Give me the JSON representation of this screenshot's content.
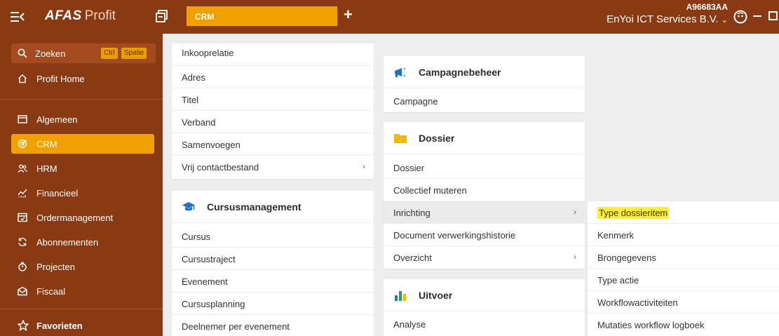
{
  "topbar": {
    "brand": "AFAS",
    "product": "Profit",
    "active_tab": "CRM",
    "add_tab": "+",
    "user_code": "A96683AA",
    "company": "EnYoi ICT Services B.V.",
    "company_caret": "⌄"
  },
  "sidebar": {
    "search_label": "Zoeken",
    "key_ctrl": "Ctrl",
    "key_space": "Spatie",
    "home": "Profit Home",
    "items": [
      {
        "label": "Algemeen"
      },
      {
        "label": "CRM"
      },
      {
        "label": "HRM"
      },
      {
        "label": "Financieel"
      },
      {
        "label": "Ordermanagement"
      },
      {
        "label": "Abonnementen"
      },
      {
        "label": "Projecten"
      },
      {
        "label": "Fiscaal"
      }
    ],
    "favorites": "Favorieten"
  },
  "col1": {
    "rows": [
      {
        "label": "Inkooprelatie"
      },
      {
        "label": "Adres"
      },
      {
        "label": "Titel"
      },
      {
        "label": "Verband"
      },
      {
        "label": "Samenvoegen"
      },
      {
        "label": "Vrij contactbestand",
        "chevron": "›"
      }
    ],
    "cursus": {
      "title": "Cursusmanagement",
      "rows": [
        {
          "label": "Cursus"
        },
        {
          "label": "Cursustraject"
        },
        {
          "label": "Evenement"
        },
        {
          "label": "Cursusplanning"
        },
        {
          "label": "Deelnemer per evenement"
        }
      ]
    }
  },
  "col2": {
    "campagne": {
      "title": "Campagnebeheer",
      "rows": [
        {
          "label": "Campagne"
        }
      ]
    },
    "dossier": {
      "title": "Dossier",
      "rows": [
        {
          "label": "Dossier"
        },
        {
          "label": "Collectief muteren"
        },
        {
          "label": "Inrichting",
          "chevron": "›"
        },
        {
          "label": "Document verwerkingshistorie"
        },
        {
          "label": "Overzicht",
          "chevron": "›"
        }
      ]
    },
    "uitvoer": {
      "title": "Uitvoer",
      "rows": [
        {
          "label": "Analyse"
        }
      ]
    }
  },
  "submenu": {
    "rows": [
      {
        "label": "Type dossieritem"
      },
      {
        "label": "Kenmerk"
      },
      {
        "label": "Brongegevens"
      },
      {
        "label": "Type actie"
      },
      {
        "label": "Workflowactiviteiten"
      },
      {
        "label": "Mutaties workflow logboek"
      }
    ]
  },
  "colors": {
    "topbar_bg": "#8a3a12",
    "accent": "#f0a100",
    "highlight": "#ffee33",
    "campagne_icon": "#1a73c8",
    "dossier_icon": "#f5b800"
  }
}
